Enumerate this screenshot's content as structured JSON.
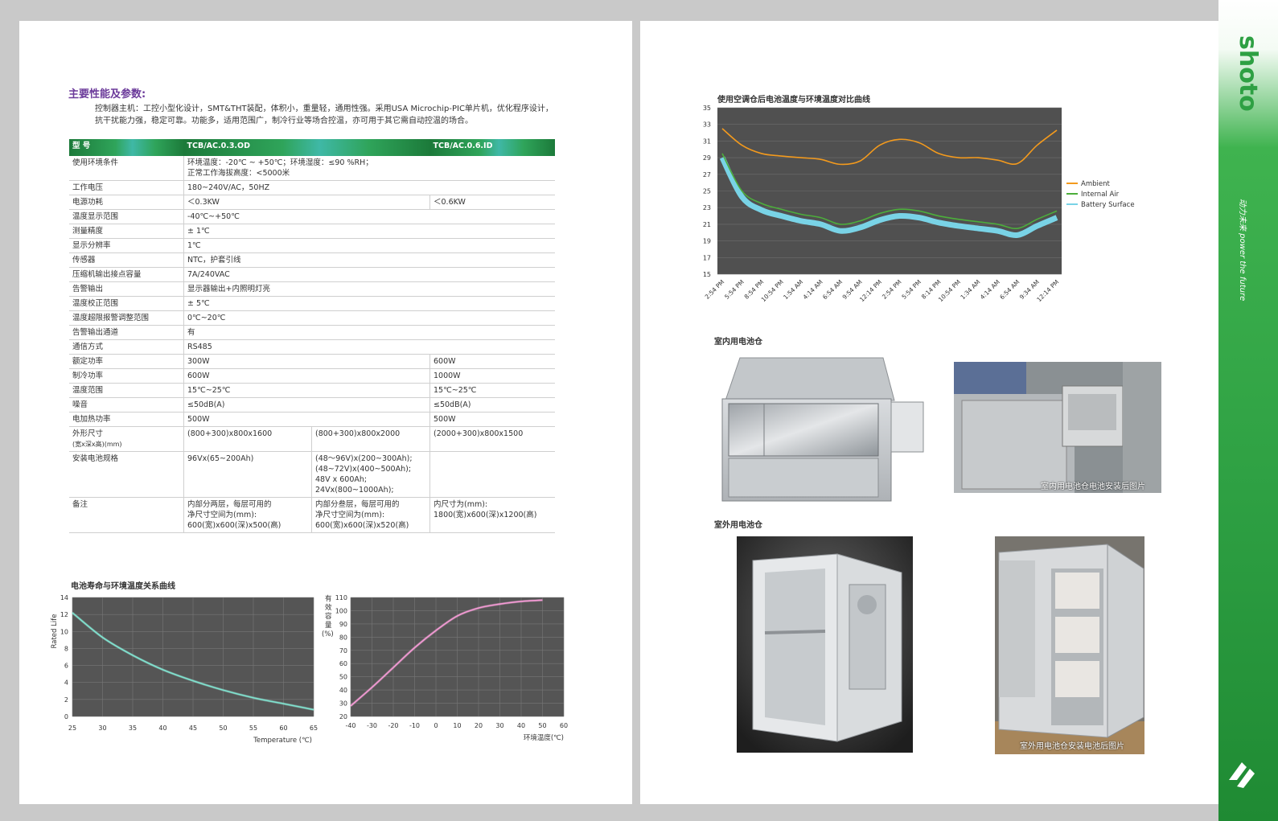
{
  "left": {
    "section_title": "主要性能及参数:",
    "intro": "控制器主机：工控小型化设计，SMT&THT装配，体积小，重量轻，通用性强。采用USA Microchip-PIC单片机，优化程序设计，抗干扰能力强，稳定可靠。功能多，适用范围广，制冷行业等场合控温，亦可用于其它需自动控温的场合。",
    "table": {
      "header": {
        "label": "型 号",
        "model_a": "TCB/AC.0.3.OD",
        "model_b": "TCB/AC.0.6.ID"
      },
      "rows": [
        {
          "label": "使用环境条件",
          "a": "环境温度：-20℃ ~ +50℃；环境湿度：≤90 %RH；\n正常工作海拔高度：<5000米",
          "b": ""
        },
        {
          "label": "工作电压",
          "a": "180~240V/AC，50HZ",
          "b": ""
        },
        {
          "label": "电源功耗",
          "a": "＜0.3KW",
          "b": "＜0.6KW"
        },
        {
          "label": "温度显示范围",
          "a": "-40℃~+50℃",
          "b": ""
        },
        {
          "label": "测量精度",
          "a": "± 1℃",
          "b": ""
        },
        {
          "label": "显示分辨率",
          "a": "1℃",
          "b": ""
        },
        {
          "label": "传感器",
          "a": "NTC，护套引线",
          "b": ""
        },
        {
          "label": "压缩机输出接点容量",
          "a": "7A/240VAC",
          "b": ""
        },
        {
          "label": "告警输出",
          "a": "显示器输出+内照明灯亮",
          "b": ""
        },
        {
          "label": "温度校正范围",
          "a": "± 5℃",
          "b": ""
        },
        {
          "label": "温度超限报警调整范围",
          "a": "0℃~20℃",
          "b": ""
        },
        {
          "label": "告警输出通道",
          "a": "有",
          "b": ""
        },
        {
          "label": "通信方式",
          "a": "RS485",
          "b": ""
        },
        {
          "label": "额定功率",
          "a": "300W",
          "b": "600W"
        },
        {
          "label": "制冷功率",
          "a": "600W",
          "b": "1000W"
        },
        {
          "label": "温度范围",
          "a": "15℃~25℃",
          "b": "15℃~25℃"
        },
        {
          "label": "噪音",
          "a": "≤50dB(A)",
          "b": "≤50dB(A)"
        },
        {
          "label": "电加热功率",
          "a": "500W",
          "b": "500W"
        }
      ],
      "dims": {
        "label": "外形尺寸",
        "sublabel": "(宽x深x高)(mm)",
        "a1": "(800+300)x800x1600",
        "a2": "(800+300)x800x2000",
        "b": "(2000+300)x800x1500"
      },
      "battery": {
        "label": "安装电池规格",
        "a1": "96Vx(65~200Ah)",
        "a2": "(48～96V)x(200~300Ah);\n(48~72V)x(400~500Ah);\n48V x 600Ah;\n24Vx(800~1000Ah);"
      },
      "notes": {
        "label": "备注",
        "a1": "内部分两层，每层可用的\n净尺寸空间为(mm):\n600(宽)x600(深)x500(高)",
        "a2": "内部分叁层，每层可用的\n净尺寸空间为(mm):\n600(宽)x600(深)x520(高)",
        "b": "内尺寸为(mm):\n1800(宽)x600(深)x1200(高)"
      }
    },
    "chart_section_title": "电池寿命与环境温度关系曲线"
  },
  "right": {
    "chart_title": "使用空调仓后电池温度与环境温度对比曲线",
    "indoor_title": "室内用电池仓",
    "indoor_caption": "室内用电池仓电池安装后图片",
    "outdoor_title": "室外用电池仓",
    "outdoor_caption": "室外用电池仓安装电池后图片",
    "brand": "shoto",
    "slogan": "动力未来 power the future"
  },
  "colors": {
    "accent_green": "#2ea043",
    "title_purple": "#6b3a9a",
    "ambient": "#f39a1d",
    "internal": "#4cae3b",
    "battery": "#79d3e6"
  },
  "chart_data": [
    {
      "type": "line",
      "title": "",
      "xlabel": "Temperature (℃)",
      "ylabel": "Rated Life",
      "x": [
        25,
        30,
        35,
        40,
        45,
        50,
        55,
        60,
        65
      ],
      "series": [
        {
          "values": [
            12.2,
            9.3,
            7.2,
            5.5,
            4.2,
            3.1,
            2.2,
            1.5,
            0.8
          ]
        }
      ],
      "xlim": [
        25,
        65
      ],
      "ylim": [
        0,
        14
      ],
      "xticks": [
        "25",
        "30",
        "35",
        "40",
        "45",
        "50",
        "55",
        "60",
        "65"
      ],
      "yticks": [
        "0",
        "2",
        "4",
        "6",
        "8",
        "10",
        "12",
        "14"
      ]
    },
    {
      "type": "line",
      "title": "",
      "xlabel": "环境温度(℃)",
      "ylabel": "有效容量(%)",
      "x": [
        -40,
        -30,
        -20,
        -10,
        0,
        10,
        20,
        30,
        40,
        50
      ],
      "series": [
        {
          "values": [
            28,
            42,
            57,
            72,
            85,
            96,
            102,
            105,
            107,
            108
          ]
        }
      ],
      "xlim": [
        -40,
        60
      ],
      "ylim": [
        20,
        110
      ],
      "xticks": [
        "-40",
        "-30",
        "-20",
        "-10",
        "0",
        "10",
        "20",
        "30",
        "40",
        "50",
        "60"
      ],
      "yticks": [
        "20",
        "30",
        "40",
        "50",
        "60",
        "70",
        "80",
        "90",
        "100",
        "110"
      ]
    },
    {
      "type": "line",
      "title": "使用空调仓后电池温度与环境温度对比曲线",
      "xlabel": "",
      "ylabel": "",
      "categories": [
        "2:54 PM",
        "5:54 PM",
        "8:54 PM",
        "10:54 PM",
        "1:54 AM",
        "4:14 AM",
        "6:54 AM",
        "9:54 AM",
        "12:14 PM",
        "2:54 PM",
        "5:54 PM",
        "8:14 PM",
        "10:54 PM",
        "1:34 AM",
        "4:14 AM",
        "6:54 AM",
        "9:34 AM",
        "12:14 PM"
      ],
      "series": [
        {
          "name": "Ambient",
          "values": [
            32.5,
            30.5,
            29.5,
            29.2,
            29.0,
            28.8,
            28.2,
            28.6,
            30.5,
            31.2,
            30.8,
            29.5,
            29.0,
            29.0,
            28.7,
            28.3,
            30.5,
            32.3
          ]
        },
        {
          "name": "Internal Air",
          "values": [
            29.5,
            25.0,
            23.5,
            22.8,
            22.2,
            21.8,
            21.0,
            21.4,
            22.3,
            22.8,
            22.6,
            22.0,
            21.6,
            21.3,
            21.0,
            20.5,
            21.6,
            22.6
          ]
        },
        {
          "name": "Battery Surface",
          "values": [
            29.0,
            24.3,
            22.7,
            22.0,
            21.4,
            21.0,
            20.2,
            20.6,
            21.5,
            22.0,
            21.8,
            21.2,
            20.8,
            20.5,
            20.2,
            19.7,
            20.8,
            21.8
          ]
        }
      ],
      "ylim": [
        15,
        35
      ],
      "yticks": [
        "15",
        "17",
        "19",
        "21",
        "23",
        "25",
        "27",
        "29",
        "31",
        "33",
        "35"
      ],
      "legend": "right",
      "grid": true
    }
  ]
}
